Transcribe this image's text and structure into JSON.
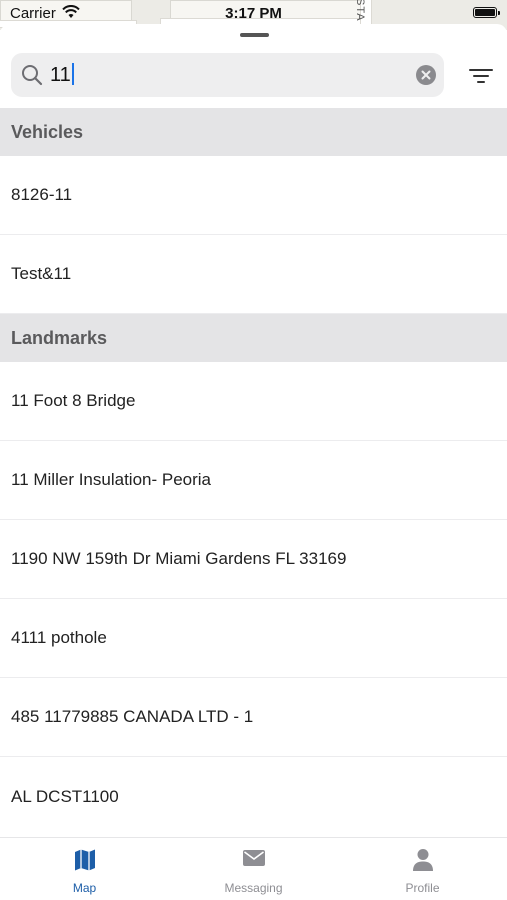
{
  "status_bar": {
    "carrier": "Carrier",
    "time": "3:17 PM"
  },
  "map": {
    "street_label": "STA"
  },
  "search": {
    "value": "11"
  },
  "sections": [
    {
      "title": "Vehicles",
      "items": [
        "8126-11",
        "Test&11"
      ]
    },
    {
      "title": "Landmarks",
      "items": [
        "11 Foot 8 Bridge",
        "11 Miller Insulation- Peoria",
        "1190 NW 159th Dr Miami Gardens FL 33169",
        "4111 pothole",
        "485 11779885 CANADA LTD - 1",
        "AL DCST1100"
      ]
    }
  ],
  "tabs": [
    {
      "label": "Map",
      "icon": "map-icon",
      "active": true
    },
    {
      "label": "Messaging",
      "icon": "mail-icon",
      "active": false
    },
    {
      "label": "Profile",
      "icon": "person-icon",
      "active": false
    }
  ],
  "colors": {
    "accent": "#1d5ea8",
    "section_bg": "#e4e4e6",
    "search_bg": "#eeeeef"
  }
}
